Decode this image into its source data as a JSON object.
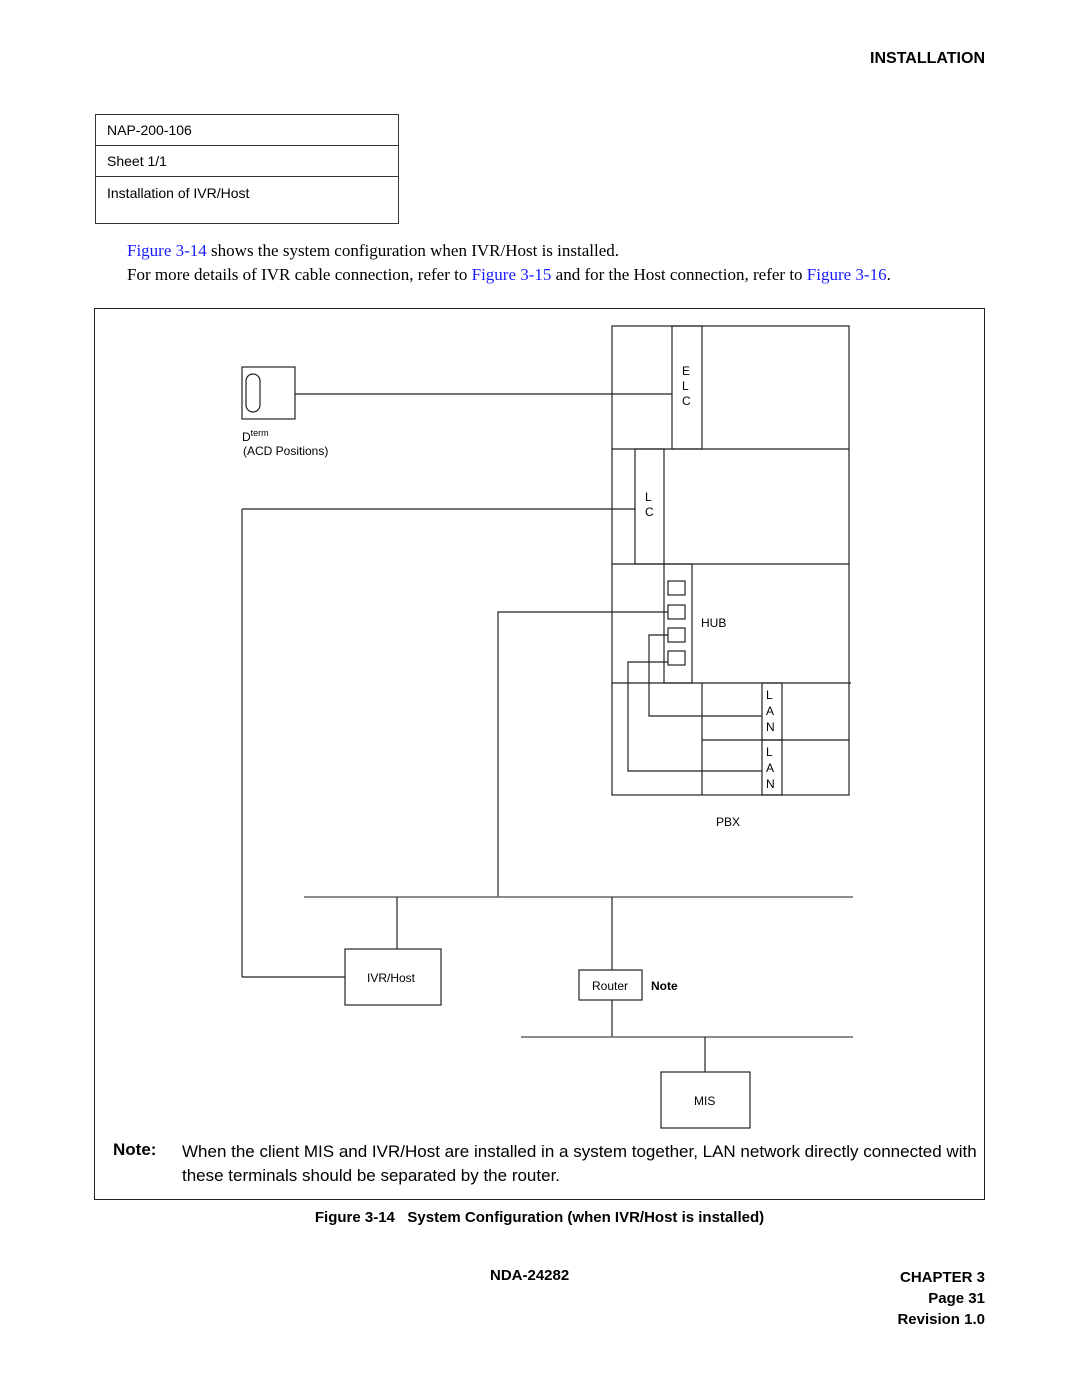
{
  "header": {
    "section_title": "INSTALLATION"
  },
  "info_table": {
    "rows": [
      "NAP-200-106",
      "Sheet 1/1",
      "Installation of IVR/Host"
    ]
  },
  "intro": {
    "line1": {
      "link": "Figure 3-14",
      "text": " shows the system configuration when IVR/Host is installed."
    },
    "line2": {
      "text_a": "For more details of IVR cable connection, refer to ",
      "link_a": "Figure 3-15",
      "text_b": " and for the Host connection, refer to ",
      "link_b": "Figure 3-16",
      "text_c": "."
    }
  },
  "diagram": {
    "dterm_label": "D",
    "dterm_sup": "term",
    "dterm_sub": "(ACD Positions)",
    "elc_letters": [
      "E",
      "L",
      "C"
    ],
    "lc_letters": [
      "L",
      "C"
    ],
    "hub_label": "HUB",
    "lan_letters": [
      "L",
      "A",
      "N"
    ],
    "pbx_label": "PBX",
    "ivr_host_label": "IVR/Host",
    "router_label": "Router",
    "router_note": "Note",
    "mis_label": "MIS"
  },
  "note": {
    "label": "Note:",
    "text": "When the client MIS and IVR/Host are installed in a system together, LAN network directly connected with these terminals should be separated by the router."
  },
  "caption": "Figure 3-14   System Configuration (when IVR/Host is installed)",
  "footer": {
    "doc_number": "NDA-24282",
    "chapter": "CHAPTER 3",
    "page": "Page 31",
    "revision": "Revision 1.0"
  }
}
